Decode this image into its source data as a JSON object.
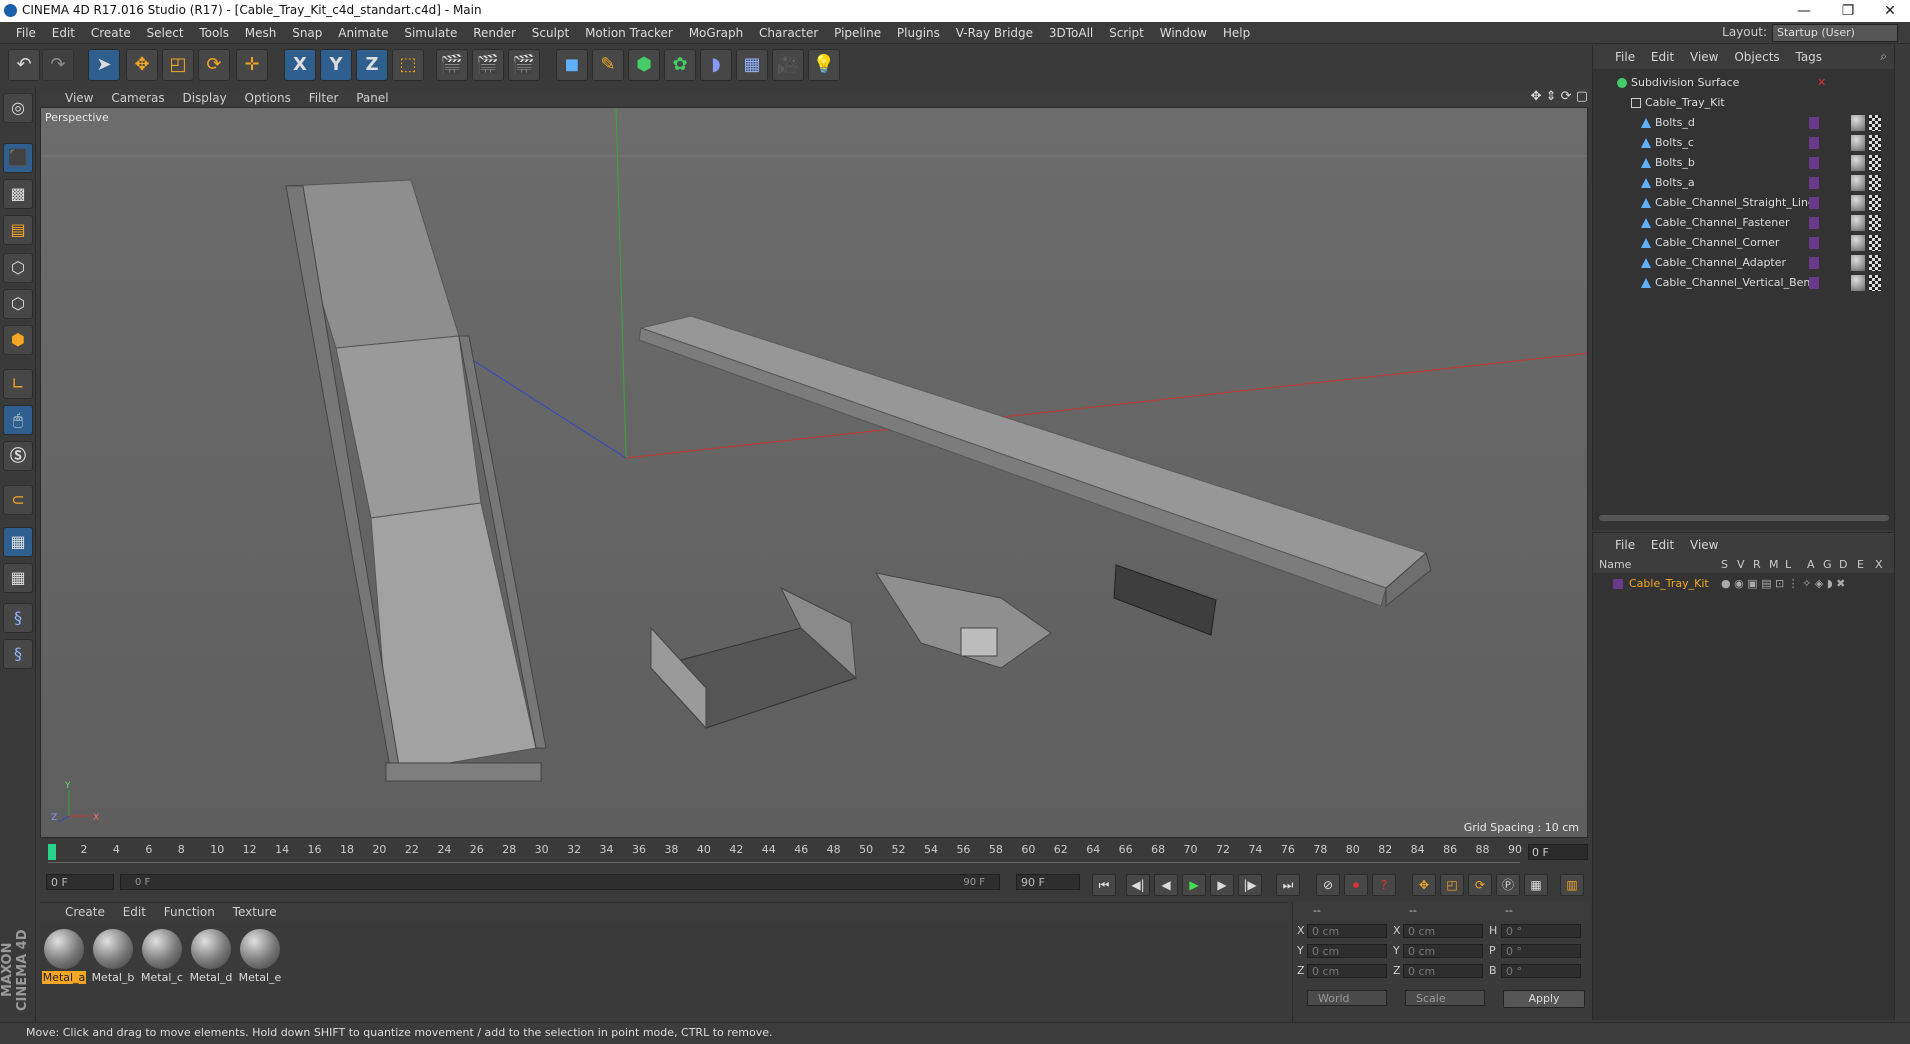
{
  "window": {
    "title": "CINEMA 4D R17.016 Studio (R17) - [Cable_Tray_Kit_c4d_standart.c4d] - Main",
    "minimize": "—",
    "restore": "❐",
    "close": "✕"
  },
  "menubar": {
    "items": [
      "File",
      "Edit",
      "Create",
      "Select",
      "Tools",
      "Mesh",
      "Snap",
      "Animate",
      "Simulate",
      "Render",
      "Sculpt",
      "Motion Tracker",
      "MoGraph",
      "Character",
      "Pipeline",
      "Plugins",
      "V-Ray Bridge",
      "3DToAll",
      "Script",
      "Window",
      "Help"
    ],
    "layout_label": "Layout:",
    "layout_value": "Startup (User)"
  },
  "toolbar": {
    "axis_x": "X",
    "axis_y": "Y",
    "axis_z": "Z"
  },
  "viewport": {
    "menu": [
      "View",
      "Cameras",
      "Display",
      "Options",
      "Filter",
      "Panel"
    ],
    "label": "Perspective",
    "grid_spacing": "Grid Spacing : 10 cm",
    "axis_labels": {
      "y": "Y",
      "x": "X",
      "z": "Z"
    }
  },
  "timeline": {
    "ticks": [
      "0",
      "2",
      "4",
      "6",
      "8",
      "10",
      "12",
      "14",
      "16",
      "18",
      "20",
      "22",
      "24",
      "26",
      "28",
      "30",
      "32",
      "34",
      "36",
      "38",
      "40",
      "42",
      "44",
      "46",
      "48",
      "50",
      "52",
      "54",
      "56",
      "58",
      "60",
      "62",
      "64",
      "66",
      "68",
      "70",
      "72",
      "74",
      "76",
      "78",
      "80",
      "82",
      "84",
      "86",
      "88",
      "90"
    ],
    "current_frame": "0 F",
    "start_field": "0 F",
    "range_start": "0 F",
    "range_end": "90 F",
    "end_field": "90 F"
  },
  "materials": {
    "menu": [
      "Create",
      "Edit",
      "Function",
      "Texture"
    ],
    "items": [
      {
        "name": "Metal_a",
        "selected": true
      },
      {
        "name": "Metal_b",
        "selected": false
      },
      {
        "name": "Metal_c",
        "selected": false
      },
      {
        "name": "Metal_d",
        "selected": false
      },
      {
        "name": "Metal_e",
        "selected": false
      }
    ]
  },
  "coordinates": {
    "headers": [
      "--",
      "--",
      "--"
    ],
    "rows": [
      {
        "l1": "X",
        "v1": "0 cm",
        "l2": "X",
        "v2": "0 cm",
        "l3": "H",
        "v3": "0 °"
      },
      {
        "l1": "Y",
        "v1": "0 cm",
        "l2": "Y",
        "v2": "0 cm",
        "l3": "P",
        "v3": "0 °"
      },
      {
        "l1": "Z",
        "v1": "0 cm",
        "l2": "Z",
        "v2": "0 cm",
        "l3": "B",
        "v3": "0 °"
      }
    ],
    "world": "World",
    "scale": "Scale",
    "apply": "Apply"
  },
  "objects": {
    "menu": [
      "File",
      "Edit",
      "View",
      "Objects",
      "Tags"
    ],
    "items": [
      {
        "name": "Subdivision Surface",
        "depth": 0,
        "icon": "subdivision-icon"
      },
      {
        "name": "Cable_Tray_Kit",
        "depth": 1,
        "icon": "null-object-icon"
      },
      {
        "name": "Bolts_d",
        "depth": 2,
        "icon": "polygon-object-icon"
      },
      {
        "name": "Bolts_c",
        "depth": 2,
        "icon": "polygon-object-icon"
      },
      {
        "name": "Bolts_b",
        "depth": 2,
        "icon": "polygon-object-icon"
      },
      {
        "name": "Bolts_a",
        "depth": 2,
        "icon": "polygon-object-icon"
      },
      {
        "name": "Cable_Channel_Straight_Line",
        "depth": 2,
        "icon": "polygon-object-icon"
      },
      {
        "name": "Cable_Channel_Fastener",
        "depth": 2,
        "icon": "polygon-object-icon"
      },
      {
        "name": "Cable_Channel_Corner",
        "depth": 2,
        "icon": "polygon-object-icon"
      },
      {
        "name": "Cable_Channel_Adapter",
        "depth": 2,
        "icon": "polygon-object-icon"
      },
      {
        "name": "Cable_Channel_Vertical_Bend",
        "depth": 2,
        "icon": "polygon-object-icon"
      }
    ]
  },
  "attributes": {
    "menu": [
      "File",
      "Edit",
      "View"
    ],
    "columns": [
      "Name",
      "S",
      "V",
      "R",
      "M",
      "L",
      "A",
      "G",
      "D",
      "E",
      "X"
    ],
    "row_name": "Cable_Tray_Kit"
  },
  "status": {
    "text": "Move: Click and drag to move elements. Hold down SHIFT to quantize movement / add to the selection in point mode, CTRL to remove."
  },
  "colors": {
    "accent": "#f5a623",
    "layer": "#6a3a8a",
    "axis_x": "#cc3333",
    "axis_y": "#33aa33",
    "axis_z": "#3344cc"
  }
}
